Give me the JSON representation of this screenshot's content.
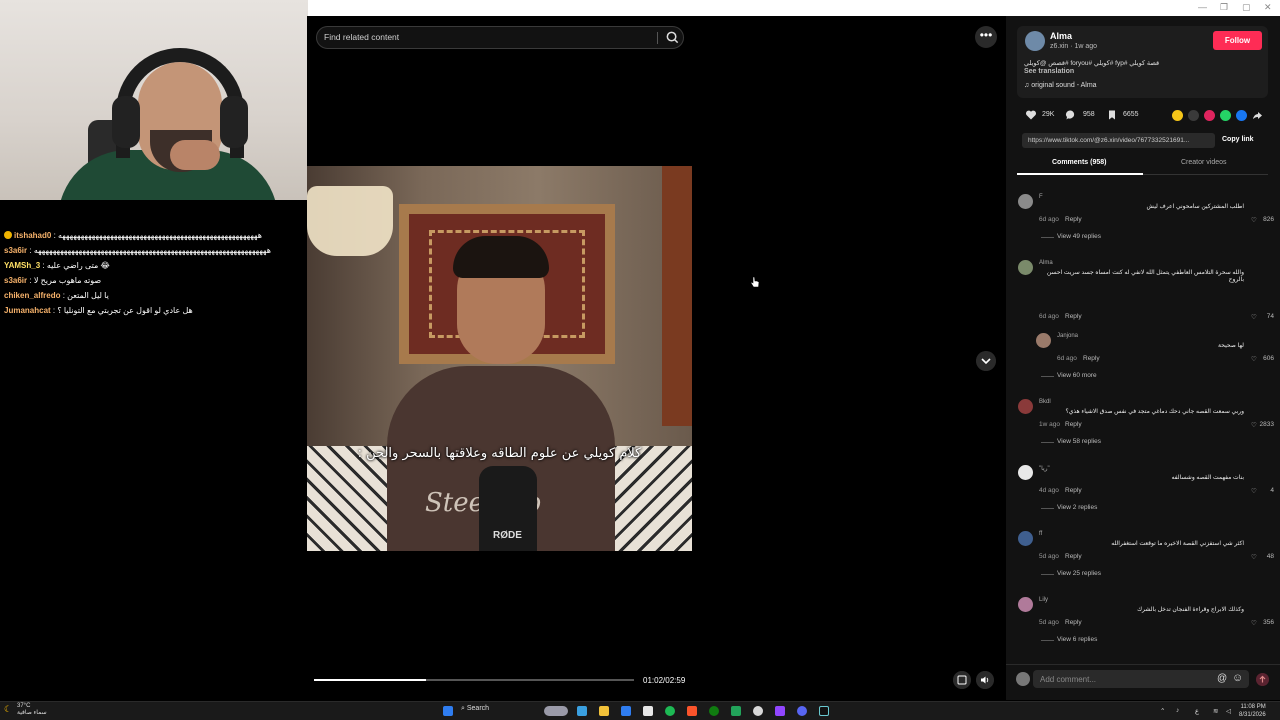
{
  "stream": {
    "chat": [
      {
        "user": "itshahad0",
        "message": "ههههههههههههههههههههههههههههههههههههههههههههههههههههههه",
        "color": "#f6b26b",
        "badge": true
      },
      {
        "user": "s3a6ir",
        "message": "هههههههههههههههههههههههههههههههههههههههههههههههههههههههههههههههه",
        "color": "#f6b26b",
        "badge": false
      },
      {
        "user": "YAMSh_3",
        "message": "متى راضي عليه 😂",
        "color": "#ffe066",
        "badge": false
      },
      {
        "user": "s3a6ir",
        "message": "صوته ماهوب مريح لا",
        "color": "#f6b26b",
        "badge": false
      },
      {
        "user": "chiken_alfredo",
        "message": "يا ليل المتعن",
        "color": "#f6b26b",
        "badge": false
      },
      {
        "user": "Jumanahcat",
        "message": "هل عادي لو اقول عن تجربتي مع التونليا ؟",
        "color": "#f6b26b",
        "badge": false
      }
    ]
  },
  "search": {
    "placeholder": "Find related content"
  },
  "video": {
    "subtitle": "كلام كويلي عن علوم الطاقه وعلاقتها بالسحر والجن :",
    "shirt_text": "Stee Lab",
    "mic_label": "RØDE",
    "progress": 0.35,
    "time": "01:02/02:59"
  },
  "post": {
    "author": "Alma",
    "meta": "z6.xin · 1w ago",
    "follow_label": "Follow",
    "caption": "قصة كويلي #fyp #كويلي #foryou #قصص @كويلي",
    "see_translation": "See translation",
    "sound": "original sound - Alma",
    "likes": "29K",
    "comments": "958",
    "saves": "6655",
    "link": "https://www.tiktok.com/@z6.xin/video/7677332521691...",
    "copy_link": "Copy link",
    "tabs": [
      "Comments (958)",
      "Creator videos"
    ]
  },
  "comments": [
    {
      "user": "F",
      "text": "اطلب المشتركين سامحوني اعرف ليش",
      "time": "6d ago",
      "reply": "Reply",
      "likes": "826",
      "view": "View 49 replies",
      "avatar": "#8a8a8a"
    },
    {
      "user": "Alma",
      "text": "والله سحرة التلامس العاطفي يتمثل الله لانفي له كنت امساه جسد سريت احسن بالروح",
      "time": "6d ago",
      "reply": "Reply",
      "likes": "74",
      "view": "",
      "avatar": "#7a8a6a"
    },
    {
      "user": "Janjona",
      "text": "لها صحيحة",
      "time": "6d ago",
      "reply": "Reply",
      "likes": "606",
      "view": "View 60 more",
      "avatar": "#9a7a6a"
    },
    {
      "user": "Bkdl",
      "text": "وربي سمعت القصه جاني دحك دماغي متجد في نفس صدق الاشياء هذي؟",
      "time": "1w ago",
      "reply": "Reply",
      "likes": "2833",
      "view": "View 58 replies",
      "avatar": "#8a3a3a"
    },
    {
      "user": "\"ريا\"",
      "text": "بنات مفهمت القصه وشسالفه",
      "time": "4d ago",
      "reply": "Reply",
      "likes": "4",
      "view": "View 2 replies",
      "avatar": "#e8e8e8"
    },
    {
      "user": "ff",
      "text": "اكثر شي استفزني القصة الاخيره ما توقعت استغفرالله",
      "time": "5d ago",
      "reply": "Reply",
      "likes": "48",
      "view": "View 25 replies",
      "avatar": "#3f5f8f"
    },
    {
      "user": "Lily",
      "text": "وكذلك الابراج وقراءة الفنجان تدخل بالشرك",
      "time": "5d ago",
      "reply": "Reply",
      "likes": "356",
      "view": "View 6 replies",
      "avatar": "#b07a9a"
    }
  ],
  "comment_box": {
    "placeholder": "Add comment..."
  },
  "taskbar": {
    "temp": "37°C",
    "weather": "سماء صافية",
    "search": "Search",
    "time": "11:08 PM",
    "date": "8/31/2026",
    "lang": "ع"
  }
}
